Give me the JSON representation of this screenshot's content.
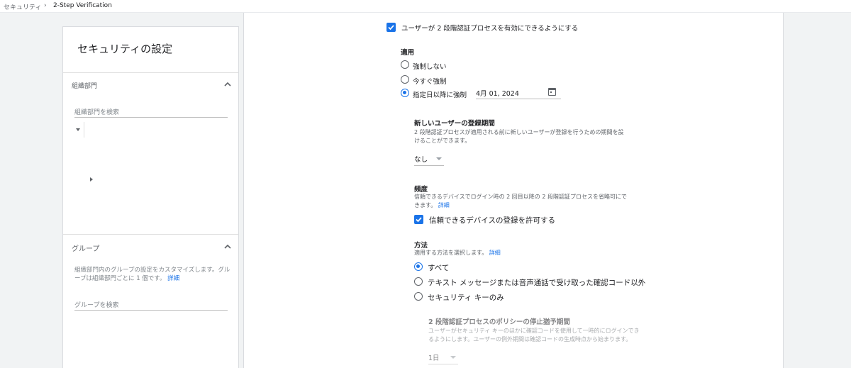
{
  "breadcrumb": {
    "root": "セキュリティ",
    "separator": "›",
    "current": "2-Step Verification"
  },
  "left": {
    "title": "セキュリティの設定",
    "org_section": {
      "label": "組織部門",
      "search_placeholder": "組織部門を検索"
    },
    "group_section": {
      "label": "グループ",
      "description": "組織部門内のグループの設定をカスタマイズします。グループは組織部門ごとに 1 個です。",
      "link": "詳細",
      "search_placeholder": "グループを検索"
    }
  },
  "main": {
    "enable_checkbox": {
      "label": "ユーザーが 2 段階認証プロセスを有効にできるようにする",
      "checked": true
    },
    "enforcement": {
      "heading": "適用",
      "options": [
        "強制しない",
        "今すぐ強制",
        "指定日以降に強制"
      ],
      "selected_index": 2,
      "date_value": "4月 01, 2024"
    },
    "enrollment": {
      "heading": "新しいユーザーの登録期間",
      "description_line1": "2 段階認証プロセスが適用される前に新しいユーザーが登録を行うための期間を設",
      "description_line2": "けることができます。",
      "selected": "なし"
    },
    "frequency": {
      "heading": "頻度",
      "description_line1": "信頼できるデバイスでログイン時の 2 回目以降の 2 段階認証プロセスを省略可にで",
      "description_line2": "きます。",
      "link": "詳細",
      "checkbox_label": "信頼できるデバイスの登録を許可する",
      "checked": true
    },
    "methods": {
      "heading": "方法",
      "description": "適用する方法を選択します。",
      "link": "詳細",
      "options": [
        "すべて",
        "テキスト メッセージまたは音声通話で受け取った確認コード以外",
        "セキュリティ キーのみ"
      ],
      "selected_index": 0
    },
    "grace_period": {
      "heading": "2 段階認証プロセスのポリシーの停止猶予期間",
      "description_line1": "ユーザーがセキュリティ キーのほかに確認コードを使用して一時的にログインでき",
      "description_line2": "るようにします。ユーザーの例外期間は確認コードの生成時点から始まります。",
      "selected": "1日"
    }
  },
  "colors": {
    "accent": "#1a73e8",
    "text": "#202124",
    "secondary": "#5f6368",
    "background": "#f1f3f4"
  }
}
